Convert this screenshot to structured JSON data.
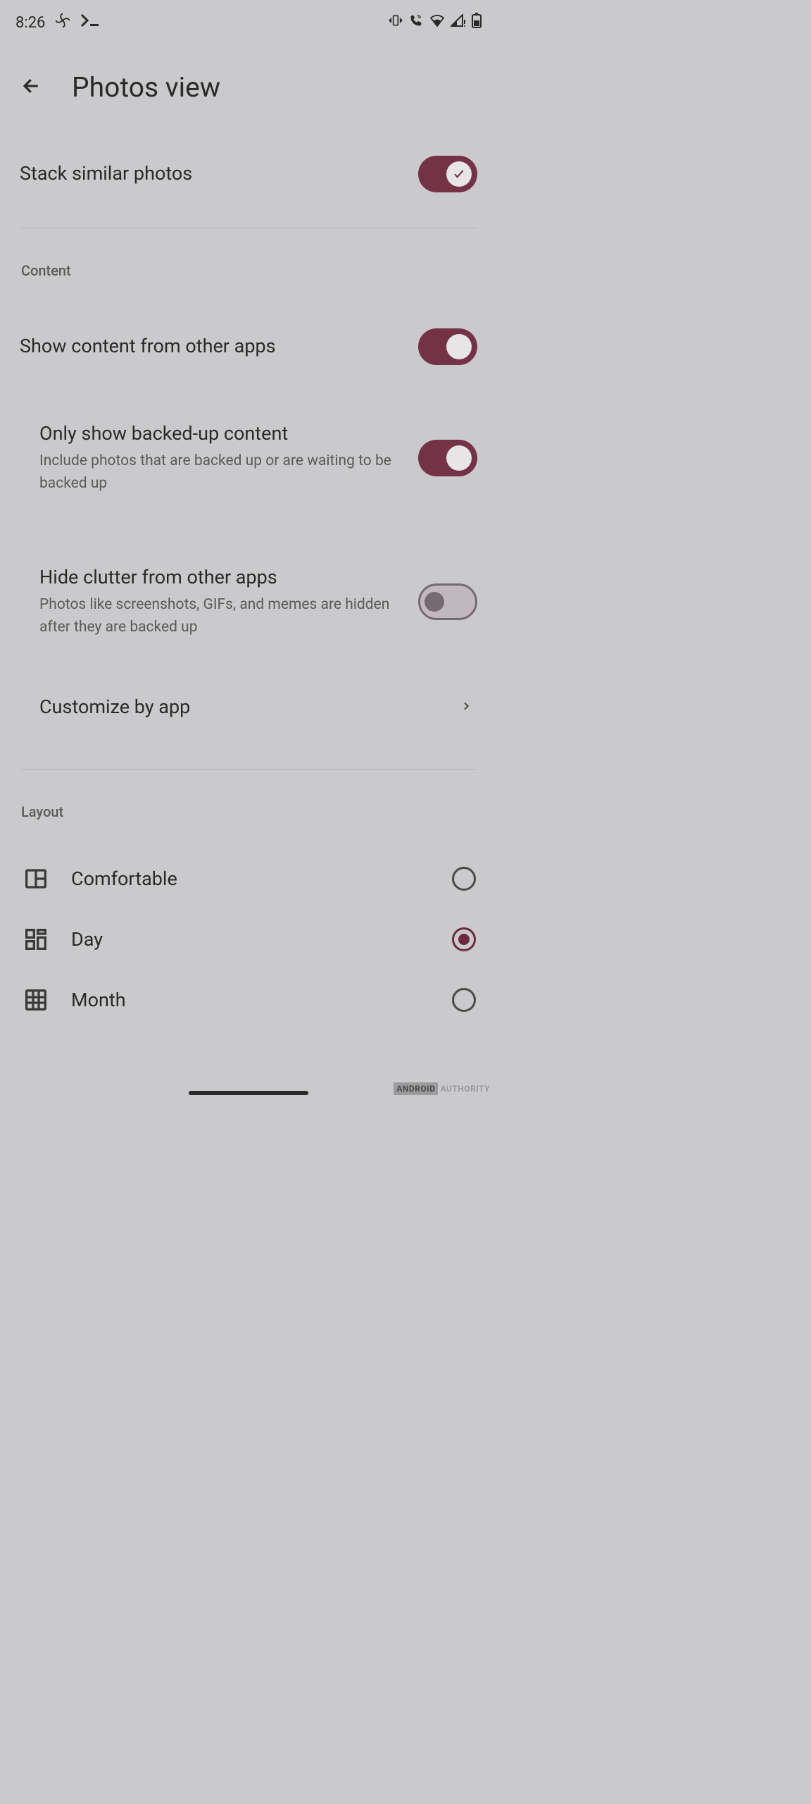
{
  "status": {
    "time": "8:26"
  },
  "header": {
    "title": "Photos view"
  },
  "settings": {
    "stack_similar": {
      "label": "Stack similar photos",
      "on": true
    }
  },
  "sections": {
    "content": {
      "header": "Content",
      "show_other_apps": {
        "label": "Show content from other apps",
        "on": true
      },
      "backed_up": {
        "label": "Only show backed-up content",
        "desc": "Include photos that are backed up or are waiting to be backed up",
        "on": true
      },
      "hide_clutter": {
        "label": "Hide clutter from other apps",
        "desc": "Photos like screenshots, GIFs, and memes are hidden after they are backed up",
        "on": false
      },
      "customize": {
        "label": "Customize by app"
      }
    },
    "layout": {
      "header": "Layout",
      "options": [
        {
          "label": "Comfortable",
          "selected": false
        },
        {
          "label": "Day",
          "selected": true
        },
        {
          "label": "Month",
          "selected": false
        }
      ]
    }
  },
  "watermark": {
    "brand": "ANDROID",
    "text": "AUTHORITY"
  }
}
